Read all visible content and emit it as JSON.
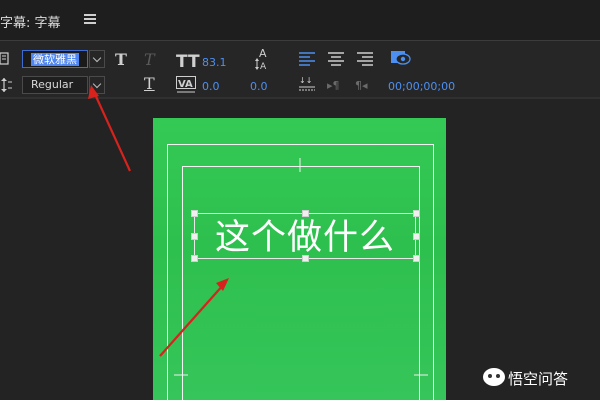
{
  "window": {
    "title": "字幕: 字幕"
  },
  "toolbar": {
    "font_family": "微软雅黑",
    "font_style": "Regular",
    "font_size": "83.1",
    "kerning": "0.0",
    "tracking": "0.0",
    "timecode": "00;00;00;00"
  },
  "canvas": {
    "caption_text": "这个做什么"
  },
  "watermark": {
    "text": "悟空问答"
  },
  "colors": {
    "accent_blue": "#4d8ff0",
    "selection_blue": "#4f86f2",
    "background_green": "#32c553",
    "annotation_red": "#d8221e"
  },
  "icons": [
    "menu-icon",
    "title-icon",
    "bold-icon",
    "italic-icon",
    "font-size-icon",
    "leading-icon",
    "kerning-icon",
    "tracking-icon",
    "underline-icon",
    "align-left-icon",
    "align-center-icon",
    "align-right-icon",
    "tab-stops-icon",
    "show-background-icon",
    "arrow-icon"
  ]
}
